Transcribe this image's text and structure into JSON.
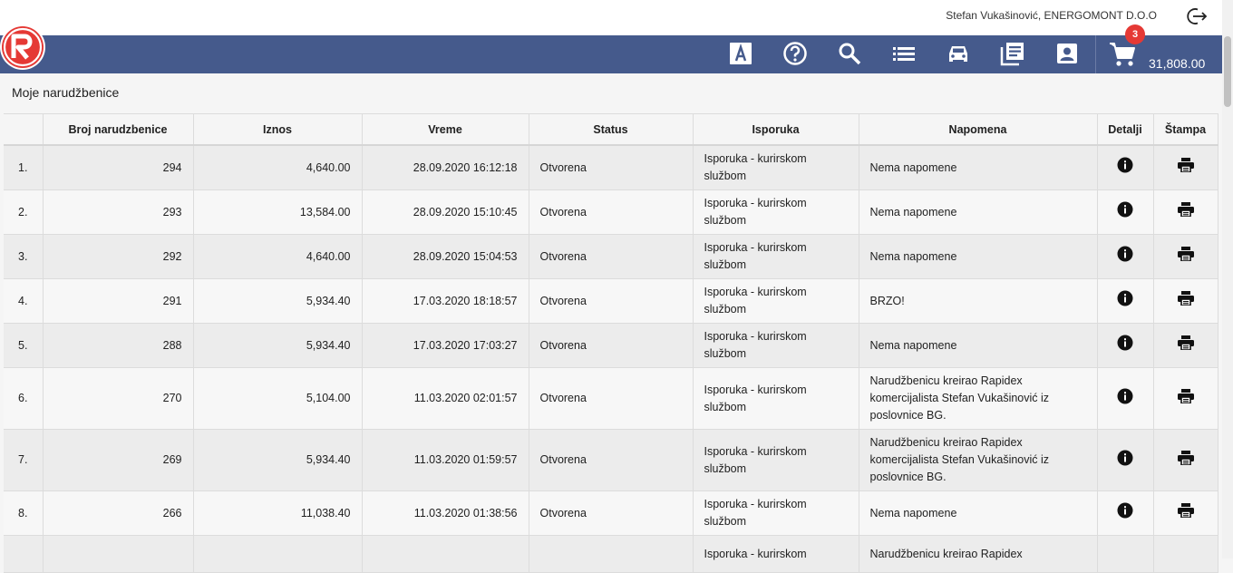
{
  "header": {
    "user_label": "Stefan Vukašinović, ENERGOMONT D.O.O",
    "cart_badge": "3",
    "cart_total": "31,808.00"
  },
  "nav_icons": [
    "letter-a-icon",
    "help-icon",
    "search-icon",
    "list-icon",
    "car-icon",
    "catalog-icon",
    "contact-icon"
  ],
  "page_title": "Moje narudžbenice",
  "table": {
    "columns": [
      "",
      "Broj narudzbenice",
      "Iznos",
      "Vreme",
      "Status",
      "Isporuka",
      "Napomena",
      "Detalji",
      "Štampa"
    ],
    "rows": [
      {
        "idx": "1.",
        "broj": "294",
        "iznos": "4,640.00",
        "vreme": "28.09.2020 16:12:18",
        "status": "Otvorena",
        "isporuka": "Isporuka - kurirskom službom",
        "napomena": "Nema napomene"
      },
      {
        "idx": "2.",
        "broj": "293",
        "iznos": "13,584.00",
        "vreme": "28.09.2020 15:10:45",
        "status": "Otvorena",
        "isporuka": "Isporuka - kurirskom službom",
        "napomena": "Nema napomene"
      },
      {
        "idx": "3.",
        "broj": "292",
        "iznos": "4,640.00",
        "vreme": "28.09.2020 15:04:53",
        "status": "Otvorena",
        "isporuka": "Isporuka - kurirskom službom",
        "napomena": "Nema napomene"
      },
      {
        "idx": "4.",
        "broj": "291",
        "iznos": "5,934.40",
        "vreme": "17.03.2020 18:18:57",
        "status": "Otvorena",
        "isporuka": "Isporuka - kurirskom službom",
        "napomena": "BRZO!"
      },
      {
        "idx": "5.",
        "broj": "288",
        "iznos": "5,934.40",
        "vreme": "17.03.2020 17:03:27",
        "status": "Otvorena",
        "isporuka": "Isporuka - kurirskom službom",
        "napomena": "Nema napomene"
      },
      {
        "idx": "6.",
        "broj": "270",
        "iznos": "5,104.00",
        "vreme": "11.03.2020 02:01:57",
        "status": "Otvorena",
        "isporuka": "Isporuka - kurirskom službom",
        "napomena": "Narudžbenicu kreirao Rapidex komercijalista Stefan Vukašinović iz poslovnice BG."
      },
      {
        "idx": "7.",
        "broj": "269",
        "iznos": "5,934.40",
        "vreme": "11.03.2020 01:59:57",
        "status": "Otvorena",
        "isporuka": "Isporuka - kurirskom službom",
        "napomena": "Narudžbenicu kreirao Rapidex komercijalista Stefan Vukašinović iz poslovnice BG."
      },
      {
        "idx": "8.",
        "broj": "266",
        "iznos": "11,038.40",
        "vreme": "11.03.2020 01:38:56",
        "status": "Otvorena",
        "isporuka": "Isporuka - kurirskom službom",
        "napomena": "Nema napomene"
      },
      {
        "idx": "",
        "broj": "",
        "iznos": "",
        "vreme": "",
        "status": "",
        "isporuka": "Isporuka - kurirskom",
        "napomena": "Narudžbenicu kreirao Rapidex"
      }
    ]
  },
  "colors": {
    "navbar": "#455a8c",
    "badge": "#e53935",
    "logo_red": "#e53935"
  }
}
